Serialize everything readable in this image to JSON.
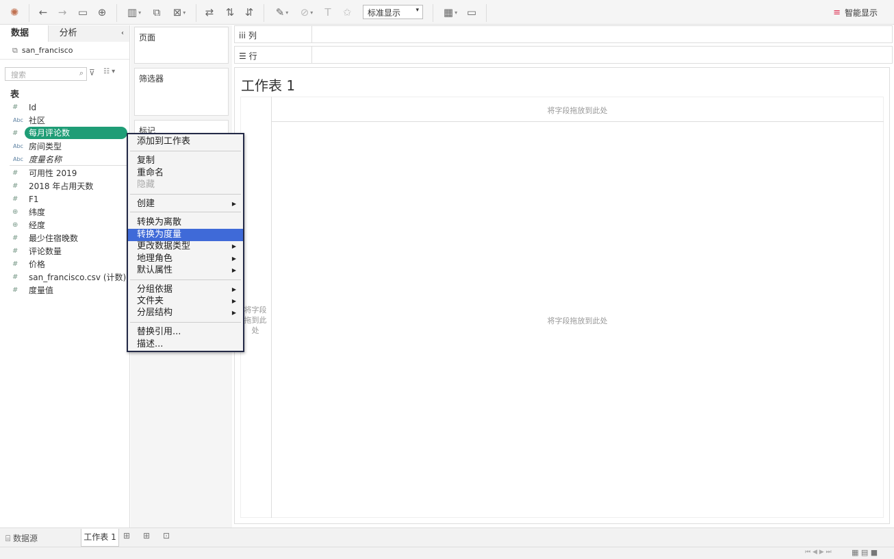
{
  "toolbar": {
    "display_select": "标准显示",
    "show_me": "智能显示",
    "icons": [
      "logo-icon",
      "undo-icon",
      "redo-icon",
      "save-icon",
      "new-datasource-icon",
      "new-worksheet-icon",
      "duplicate-icon",
      "clear-icon",
      "swap-icon",
      "sort-asc-icon",
      "sort-desc-icon",
      "highlight-icon",
      "group-icon",
      "label-icon",
      "pin-icon",
      "chart-size-icon",
      "presentation-icon"
    ]
  },
  "left_pane": {
    "tabs": [
      "数据",
      "分析"
    ],
    "datasource": "san_francisco",
    "search_placeholder": "搜索",
    "section_title": "表",
    "fields": [
      {
        "icon": "#",
        "name": "Id"
      },
      {
        "icon": "Abc",
        "name": "社区"
      },
      {
        "icon": "#",
        "name": "每月评论数"
      },
      {
        "icon": "Abc",
        "name": "房间类型"
      },
      {
        "icon": "Abc",
        "name": "度量名称"
      },
      {
        "icon": "#",
        "name": "可用性 2019"
      },
      {
        "icon": "#",
        "name": "2018 年占用天数"
      },
      {
        "icon": "#",
        "name": "F1"
      },
      {
        "icon": "globe",
        "name": "纬度"
      },
      {
        "icon": "globe",
        "name": "经度"
      },
      {
        "icon": "#",
        "name": "最少住宿晚数"
      },
      {
        "icon": "#",
        "name": "评论数量"
      },
      {
        "icon": "#",
        "name": "价格"
      },
      {
        "icon": "#",
        "name": "san_francisco.csv (计数)"
      },
      {
        "icon": "#",
        "name": "度量值"
      }
    ]
  },
  "cards": {
    "pages": "页面",
    "filters": "筛选器",
    "marks": "标记"
  },
  "shelves": {
    "columns": "列",
    "rows": "行"
  },
  "sheet": {
    "title": "工作表 1",
    "drop_top": "将字段拖放到此处",
    "drop_center": "将字段拖放到此处",
    "drop_left": "将字段拖到此处"
  },
  "context_menu": {
    "items": [
      {
        "label": "添加到工作表"
      },
      {
        "label": "复制"
      },
      {
        "label": "重命名"
      },
      {
        "label": "隐藏",
        "disabled": true
      },
      {
        "label": "创建",
        "submenu": true
      },
      {
        "label": "转换为离散"
      },
      {
        "label": "转换为度量",
        "selected": true
      },
      {
        "label": "更改数据类型",
        "submenu": true
      },
      {
        "label": "地理角色",
        "submenu": true
      },
      {
        "label": "默认属性",
        "submenu": true
      },
      {
        "label": "分组依据",
        "submenu": true
      },
      {
        "label": "文件夹",
        "submenu": true
      },
      {
        "label": "分层结构",
        "submenu": true
      },
      {
        "label": "替换引用..."
      },
      {
        "label": "描述..."
      }
    ]
  },
  "bottom_tabs": {
    "datasource": "数据源",
    "sheet": "工作表 1"
  }
}
